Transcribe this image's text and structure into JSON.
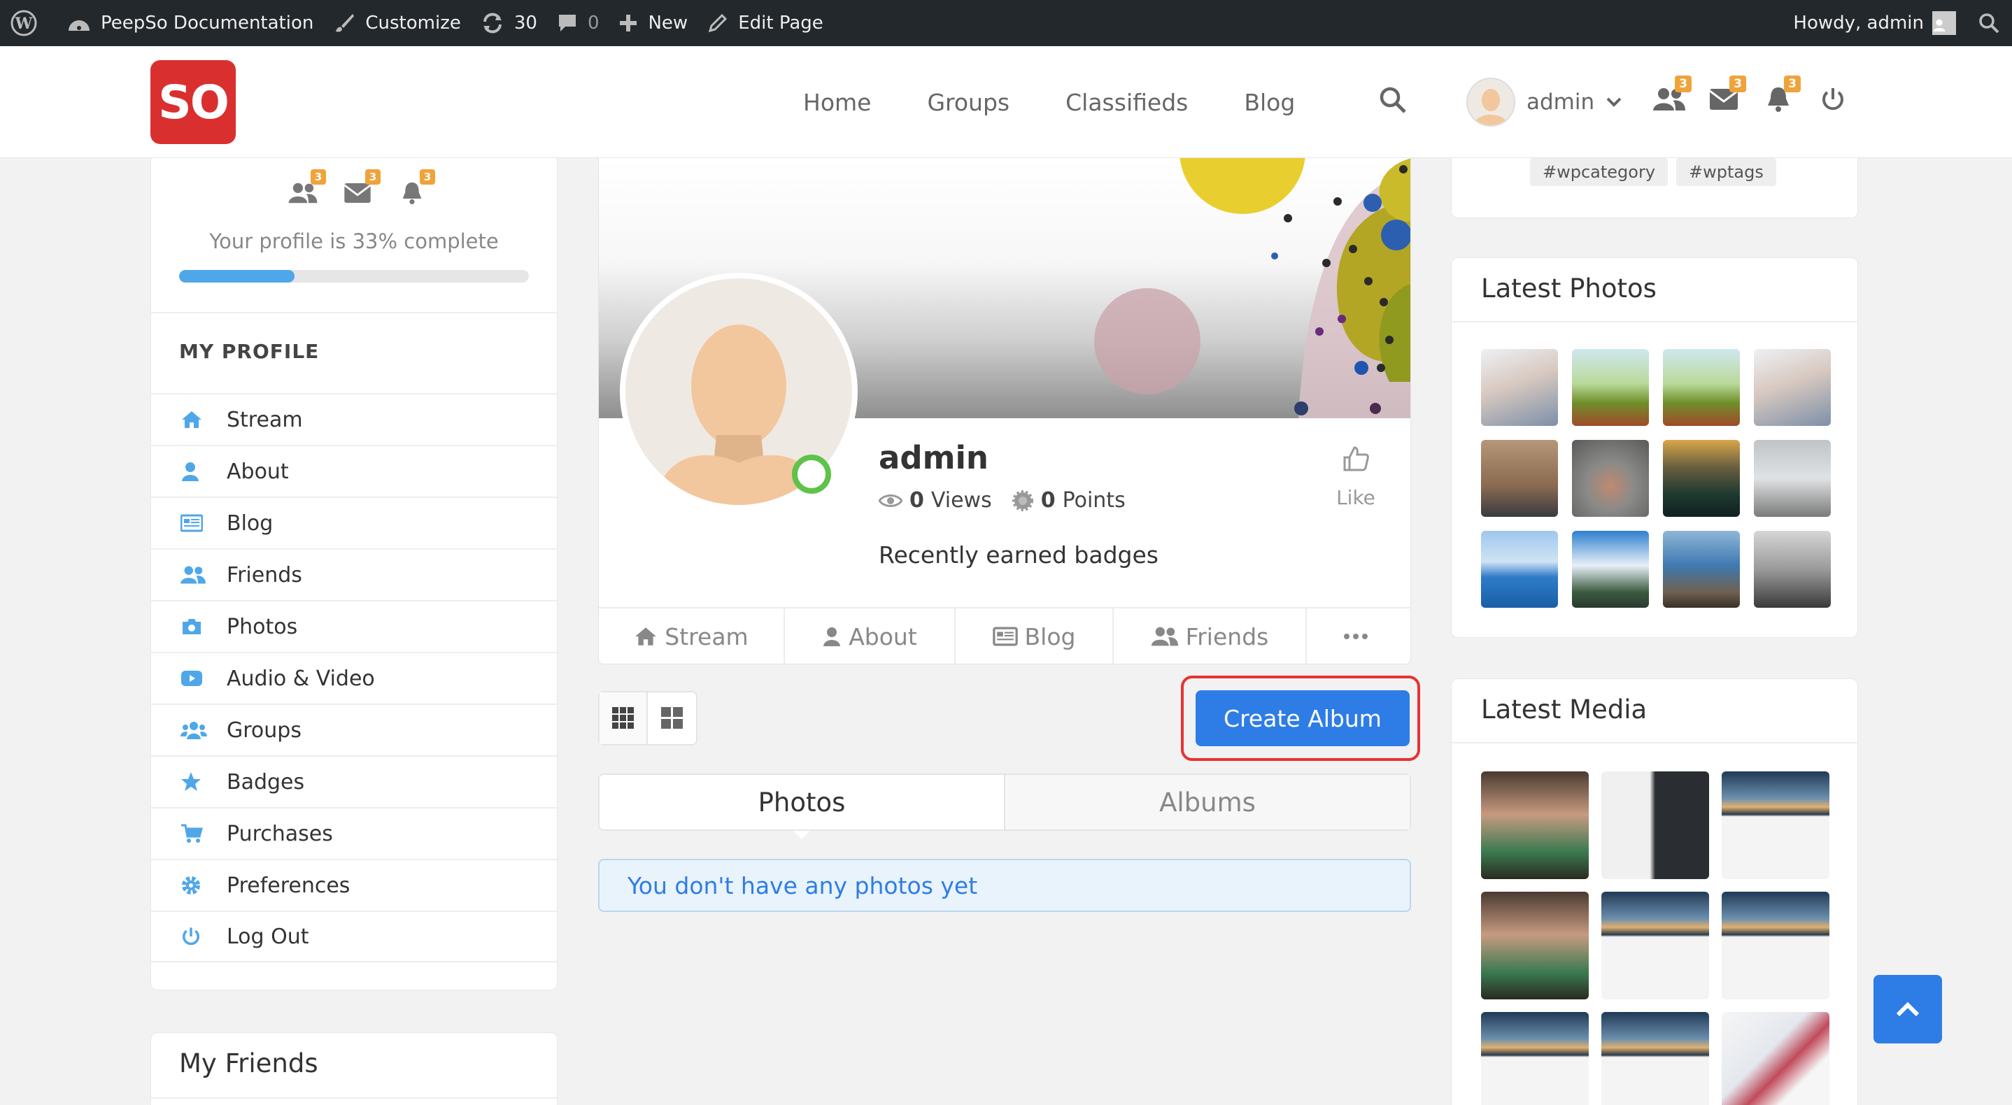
{
  "adminbar": {
    "site_name": "PeepSo Documentation",
    "customize": "Customize",
    "updates_count": "30",
    "comments_count": "0",
    "new_label": "New",
    "edit_page": "Edit Page",
    "howdy": "Howdy, admin"
  },
  "header": {
    "logo_text": "SO",
    "nav": [
      "Home",
      "Groups",
      "Classifieds",
      "Blog"
    ],
    "user_name": "admin",
    "badges": {
      "friends": "3",
      "messages": "3",
      "notifications": "3"
    }
  },
  "left": {
    "badges": {
      "friends": "3",
      "messages": "3",
      "notifications": "3"
    },
    "profile_complete": "Your profile is 33% complete",
    "profile_complete_fraction": 0.33,
    "section_title": "MY PROFILE",
    "menu": [
      "Stream",
      "About",
      "Blog",
      "Friends",
      "Photos",
      "Audio & Video",
      "Groups",
      "Badges",
      "Purchases",
      "Preferences",
      "Log Out"
    ],
    "friends_title": "My Friends"
  },
  "profile": {
    "name": "admin",
    "views_count": "0",
    "views_label": "Views",
    "points_count": "0",
    "points_label": "Points",
    "like_label": "Like",
    "badges_label": "Recently earned badges",
    "tabs": [
      "Stream",
      "About",
      "Blog",
      "Friends"
    ]
  },
  "photos": {
    "create_album": "Create Album",
    "tab_photos": "Photos",
    "tab_albums": "Albums",
    "empty_notice": "You don't have any photos yet"
  },
  "right": {
    "tags": [
      "#wpcategory",
      "#wptags"
    ],
    "latest_photos_title": "Latest Photos",
    "latest_media_title": "Latest Media"
  },
  "colors": {
    "accent": "#2e7de6",
    "logo": "#d9302f",
    "badge": "#f0a33a",
    "online": "#5fc24a",
    "highlight": "#e53333"
  }
}
